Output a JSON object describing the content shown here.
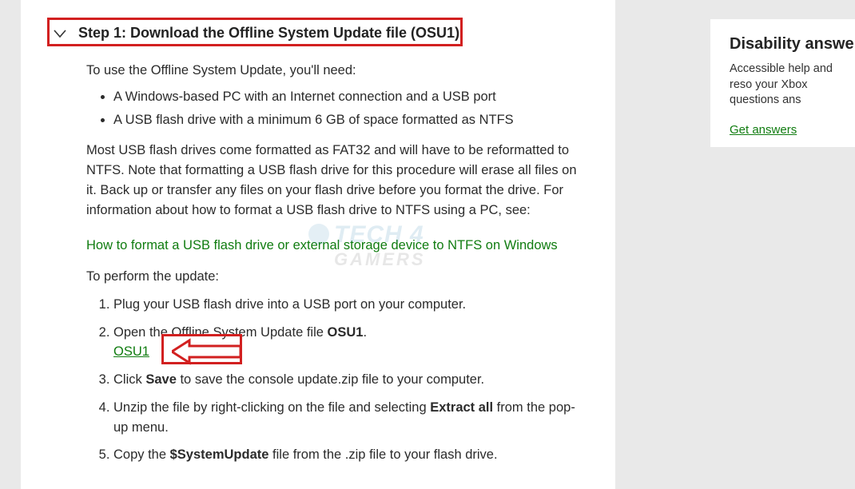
{
  "main": {
    "step_title": "Step 1: Download the Offline System Update file (OSU1)",
    "intro": "To use the Offline System Update, you'll need:",
    "needs": [
      "A Windows-based PC with an Internet connection and a USB port",
      "A USB flash drive with a minimum 6 GB of space formatted as NTFS"
    ],
    "fat32_note": "Most USB flash drives come formatted as FAT32 and will have to be reformatted to NTFS. Note that formatting a USB flash drive for this procedure will erase all files on it. Back up or transfer any files on your flash drive before you format the drive. For information about how to format a USB flash drive to NTFS using a PC, see:",
    "ntfs_link": "How to format a USB flash drive or external storage device to NTFS on Windows",
    "perform": "To perform the update:",
    "steps": {
      "s1": "Plug your USB flash drive into a USB port on your computer.",
      "s2_a": "Open the Offline System Update file ",
      "s2_b": "OSU1",
      "s2_c": ".",
      "s2_link": "OSU1",
      "s3_a": "Click ",
      "s3_b": "Save",
      "s3_c": " to save the console update.zip file to your computer.",
      "s4_a": "Unzip the file by right-clicking on the file and selecting ",
      "s4_b": "Extract all",
      "s4_c": " from the pop-up menu.",
      "s5_a": "Copy the ",
      "s5_b": "$SystemUpdate",
      "s5_c": " file from the .zip file to your flash drive."
    }
  },
  "sidebar": {
    "title": "Disability answe",
    "text": "Accessible help and reso your Xbox questions ans",
    "link": "Get answers"
  },
  "watermark": {
    "line1": "TECH 4",
    "line2": "GAMERS"
  }
}
